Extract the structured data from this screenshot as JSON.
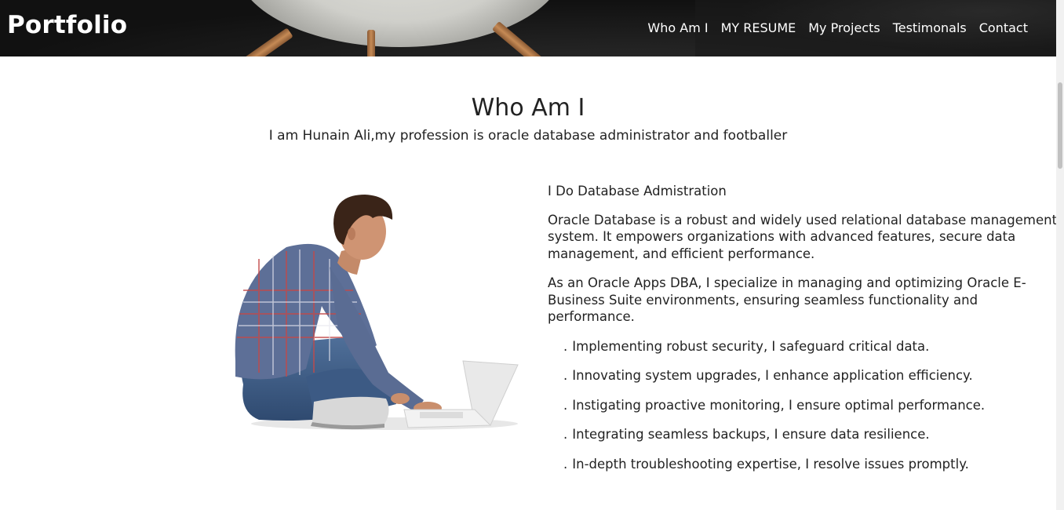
{
  "header": {
    "brand": "Portfolio",
    "nav": [
      "Who Am I",
      "MY RESUME",
      "My Projects",
      "Testimonals",
      "Contact"
    ]
  },
  "about": {
    "title": "Who Am I",
    "subtitle": "I am Hunain Ali,my profession is oracle database administrator and footballer",
    "heading": "I Do Database Admistration",
    "paragraph1": "Oracle Database is a robust and widely used relational database management system. It empowers organizations with advanced features, secure data management, and efficient performance.",
    "paragraph2": "As an Oracle Apps DBA, I specialize in managing and optimizing Oracle E-Business Suite environments, ensuring seamless functionality and performance.",
    "bullets": [
      "Implementing robust security, I safeguard critical data.",
      "Innovating system upgrades, I enhance application efficiency.",
      "Instigating proactive monitoring, I ensure optimal performance.",
      "Integrating seamless backups, I ensure data resilience.",
      "In-depth troubleshooting expertise, I resolve issues promptly."
    ],
    "bullet_marker": "."
  },
  "colors": {
    "header_bg": "#1b1b1b",
    "header_text": "#ffffff",
    "body_text": "#222222",
    "page_bg": "#ffffff"
  }
}
